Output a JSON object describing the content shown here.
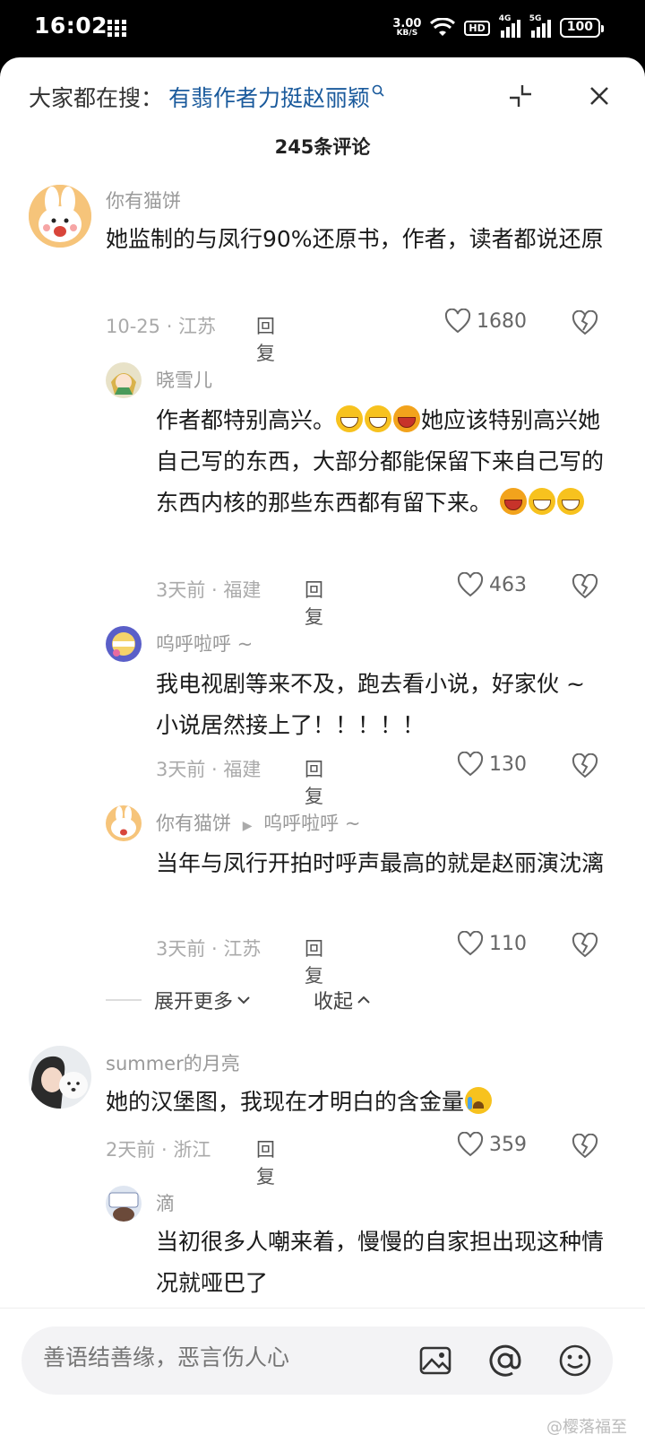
{
  "status": {
    "time": "16:02",
    "net_speed": "3.00",
    "net_unit": "KB/S",
    "hd": "HD",
    "sig1": "4G",
    "sig2": "5G",
    "battery": "100"
  },
  "header": {
    "search_prefix": "大家都在搜：",
    "search_term": "有翡作者力挺赵丽颖",
    "comment_count": "245条评论"
  },
  "comments": [
    {
      "user": "你有猫饼",
      "text": "她监制的与凤行90%还原书，作者，读者都说还原",
      "meta": "10-25 · 江苏",
      "reply": "回复",
      "likes": "1680"
    },
    {
      "user": "晓雪儿",
      "text_a": "作者都特别高兴。",
      "text_b": "她应该特别高兴她自己写的东西，大部分都能保留下来自己写的东西内核的那些东西都有留下来。",
      "meta": "3天前 · 福建",
      "reply": "回复",
      "likes": "463"
    },
    {
      "user": "呜呼啦呼 ~",
      "text": "我电视剧等来不及，跑去看小说，好家伙 ~ 小说居然接上了！！！！！",
      "meta": "3天前 · 福建",
      "reply": "回复",
      "likes": "130"
    },
    {
      "user": "你有猫饼",
      "reply_to": "呜呼啦呼 ~",
      "text": "当年与凤行开拍时呼声最高的就是赵丽演沈漓",
      "meta": "3天前 · 江苏",
      "reply": "回复",
      "likes": "110"
    },
    {
      "user": "summer的月亮",
      "text": "她的汉堡图，我现在才明白的含金量",
      "meta": "2天前 · 浙江",
      "reply": "回复",
      "likes": "359"
    },
    {
      "user": "滴",
      "text": "当初很多人嘲来着，慢慢的自家担出现这种情况就哑巴了"
    }
  ],
  "thread": {
    "expand_more": "展开更多",
    "collapse": "收起"
  },
  "input": {
    "placeholder": "善语结善缘，恶言伤人心"
  },
  "watermark": "@樱落福至"
}
